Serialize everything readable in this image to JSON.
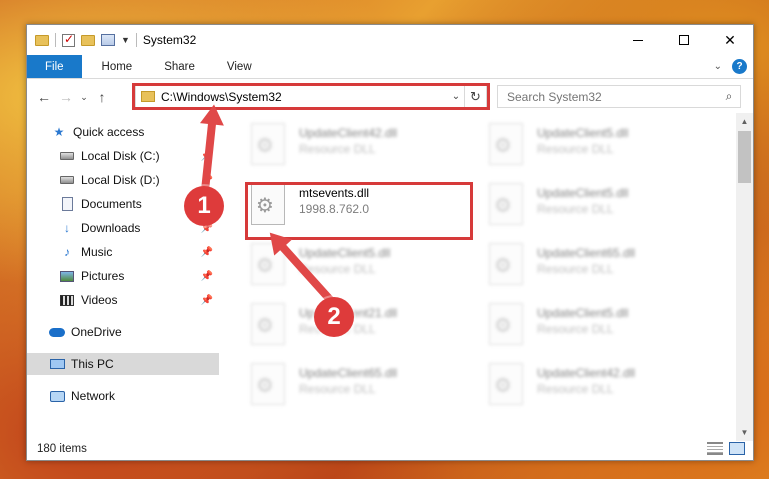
{
  "window": {
    "title": "System32",
    "controls": {
      "minimize": "–",
      "maximize": "",
      "close": "✕"
    }
  },
  "ribbon": {
    "tabs": [
      "File",
      "Home",
      "Share",
      "View"
    ],
    "collapse": "⌄",
    "help": "?"
  },
  "navigation": {
    "back": "←",
    "forward": "→",
    "recent": "⌄",
    "up": "↑",
    "address": "C:\\Windows\\System32",
    "address_dropdown": "⌄",
    "refresh": "↻",
    "search_placeholder": "Search System32",
    "search_icon": "⌕"
  },
  "sidebar": {
    "items": [
      {
        "label": "Quick access",
        "icon": "star-icon",
        "pinned": false
      },
      {
        "label": "Local Disk (C:)",
        "icon": "disk-icon",
        "pinned": true
      },
      {
        "label": "Local Disk (D:)",
        "icon": "disk-icon",
        "pinned": true
      },
      {
        "label": "Documents",
        "icon": "document-icon",
        "pinned": true
      },
      {
        "label": "Downloads",
        "icon": "download-arrow-icon",
        "pinned": true
      },
      {
        "label": "Music",
        "icon": "music-note-icon",
        "pinned": true
      },
      {
        "label": "Pictures",
        "icon": "picture-icon",
        "pinned": true
      },
      {
        "label": "Videos",
        "icon": "film-icon",
        "pinned": true
      },
      {
        "label": "OneDrive",
        "icon": "cloud-icon",
        "pinned": false
      },
      {
        "label": "This PC",
        "icon": "computer-icon",
        "pinned": false
      },
      {
        "label": "Network",
        "icon": "network-icon",
        "pinned": false
      }
    ],
    "pin_glyph": "📌"
  },
  "files": [
    {
      "name": "UpdateClient42.dll",
      "type": "Resource DLL"
    },
    {
      "name": "UpdateClient5.dll",
      "type": "Resource DLL"
    },
    {
      "name": "mtsevents.dll",
      "type": "1998.8.762.0"
    },
    {
      "name": "UpdateClient5.dll",
      "type": "Resource DLL"
    },
    {
      "name": "UpdateClient5.dll",
      "type": "Resource DLL"
    },
    {
      "name": "UpdateClient65.dll",
      "type": "Resource DLL"
    },
    {
      "name": "UpdateClient21.dll",
      "type": "Resource DLL"
    },
    {
      "name": "UpdateClient5.dll",
      "type": "Resource DLL"
    },
    {
      "name": "UpdateClient65.dll",
      "type": "Resource DLL"
    },
    {
      "name": "UpdateClient42.dll",
      "type": "Resource DLL"
    }
  ],
  "status": {
    "item_count": "180 items"
  },
  "annotations": {
    "step1": "1",
    "step2": "2",
    "color": "#d63a3a"
  },
  "colors": {
    "accent": "#1979ca",
    "selection": "#d9d9d9"
  }
}
